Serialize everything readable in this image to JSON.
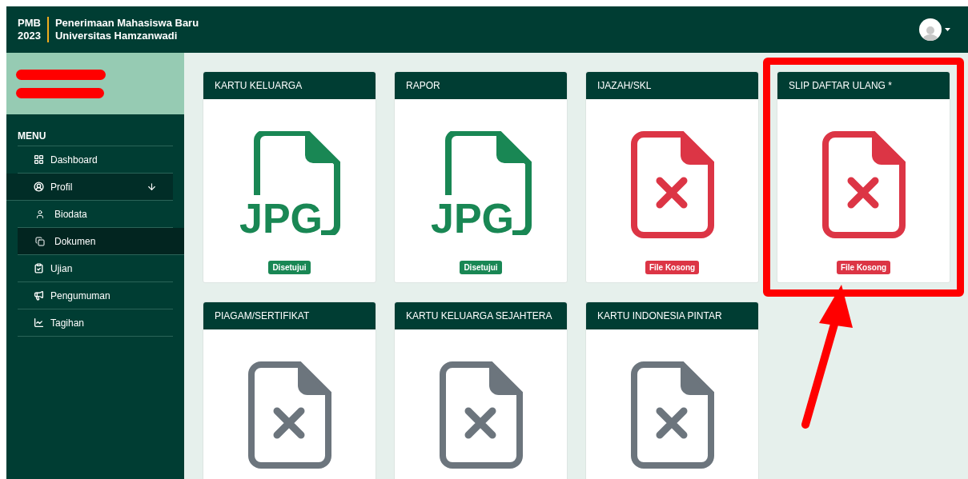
{
  "header": {
    "short_title": [
      "PMB",
      "2023"
    ],
    "title": [
      "Penerimaan Mahasiswa Baru",
      "Universitas Hamzanwadi"
    ]
  },
  "sidebar": {
    "menu_label": "MENU",
    "items": [
      {
        "label": "Dashboard",
        "selected": false
      },
      {
        "label": "Profil",
        "selected": false,
        "expanded": true,
        "children": [
          {
            "label": "Biodata",
            "selected": false
          },
          {
            "label": "Dokumen",
            "selected": true
          }
        ]
      },
      {
        "label": "Ujian",
        "selected": false
      },
      {
        "label": "Pengumuman",
        "selected": false
      },
      {
        "label": "Tagihan",
        "selected": false
      }
    ]
  },
  "documents": [
    {
      "title": "KARTU KELUARGA",
      "kind": "jpg",
      "file_label": "JPG",
      "status": {
        "kind": "approved",
        "text": "Disetujui"
      },
      "highlighted": false
    },
    {
      "title": "RAPOR",
      "kind": "jpg",
      "file_label": "JPG",
      "status": {
        "kind": "approved",
        "text": "Disetujui"
      },
      "highlighted": false
    },
    {
      "title": "IJAZAH/SKL",
      "kind": "missing",
      "status": {
        "kind": "empty",
        "text": "File Kosong"
      },
      "highlighted": false
    },
    {
      "title": "SLIP DAFTAR ULANG *",
      "kind": "missing",
      "status": {
        "kind": "empty",
        "text": "File Kosong"
      },
      "highlighted": true
    },
    {
      "title": "PIAGAM/SERTIFIKAT",
      "kind": "optional",
      "highlighted": false
    },
    {
      "title": "KARTU KELUARGA SEJAHTERA",
      "kind": "optional",
      "highlighted": false
    },
    {
      "title": "KARTU INDONESIA PINTAR",
      "kind": "optional",
      "highlighted": false
    }
  ]
}
